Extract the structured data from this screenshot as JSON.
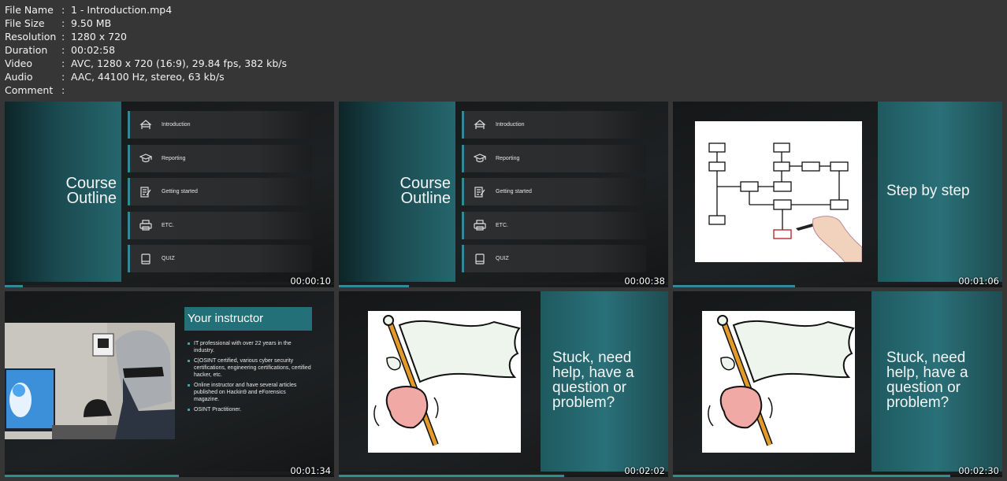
{
  "info": {
    "rows": [
      {
        "key": "File Name",
        "value": "1 - Introduction.mp4"
      },
      {
        "key": "File Size",
        "value": "9.50 MB"
      },
      {
        "key": "Resolution",
        "value": "1280 x 720"
      },
      {
        "key": "Duration",
        "value": "00:02:58"
      },
      {
        "key": "Video",
        "value": "AVC, 1280 x 720 (16:9), 29.84 fps, 382 kb/s"
      },
      {
        "key": "Audio",
        "value": "AAC, 44100 Hz, stereo, 63 kb/s"
      },
      {
        "key": "Comment",
        "value": ""
      }
    ],
    "separator": ":"
  },
  "outline": {
    "title_line1": "Course",
    "title_line2": "Outline",
    "items": [
      {
        "label": "Introduction",
        "icon": "hands-icon"
      },
      {
        "label": "Reporting",
        "icon": "graduation-cap-icon"
      },
      {
        "label": "Getting started",
        "icon": "document-pen-icon"
      },
      {
        "label": "ETC.",
        "icon": "printer-icon"
      },
      {
        "label": "QUIZ",
        "icon": "tablet-icon"
      }
    ]
  },
  "thumbnails": [
    {
      "timecode": "00:00:10",
      "progress": 0.056
    },
    {
      "timecode": "00:00:38",
      "progress": 0.213
    },
    {
      "timecode": "00:01:06",
      "progress": 0.371,
      "caption": "Step by step"
    },
    {
      "timecode": "00:01:34",
      "progress": 0.528
    },
    {
      "timecode": "00:02:02",
      "progress": 0.685,
      "caption_lines": [
        "Stuck, need",
        "help, have a",
        "question or",
        "problem?"
      ]
    },
    {
      "timecode": "00:02:30",
      "progress": 0.843,
      "caption_lines": [
        "Stuck, need",
        "help, have a",
        "question or",
        "problem?"
      ]
    }
  ],
  "instructor": {
    "title": "Your instructor",
    "bullets": [
      "IT professional with over 22 years in the industry.",
      "C|OSINT certified, various cyber security certifications, engineering certifications, certified hacker, etc.",
      "Online instructor and have several articles published on Hackin9 and eForensics magazine.",
      "OSINT Practitioner."
    ]
  },
  "colors": {
    "background": "#363636",
    "accent_teal": "#2f8a92",
    "progress": "#2e8c94"
  }
}
